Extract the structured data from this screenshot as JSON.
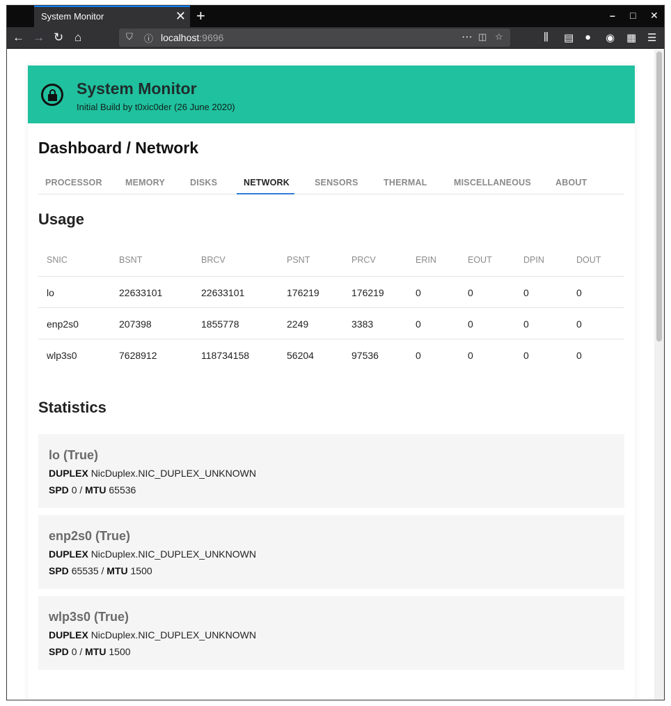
{
  "browser": {
    "tab_title": "System Monitor",
    "url_host": "localhost",
    "url_port": ":9696"
  },
  "header": {
    "title": "System Monitor",
    "subtitle": "Initial Build by t0xic0der (26 June 2020)"
  },
  "breadcrumb": "Dashboard / Network",
  "tabs": [
    {
      "label": "PROCESSOR"
    },
    {
      "label": "MEMORY"
    },
    {
      "label": "DISKS"
    },
    {
      "label": "NETWORK"
    },
    {
      "label": "SENSORS"
    },
    {
      "label": "THERMAL"
    },
    {
      "label": "MISCELLANEOUS"
    },
    {
      "label": "ABOUT"
    }
  ],
  "active_tab": "NETWORK",
  "usage": {
    "heading": "Usage",
    "columns": [
      "SNIC",
      "BSNT",
      "BRCV",
      "PSNT",
      "PRCV",
      "ERIN",
      "EOUT",
      "DPIN",
      "DOUT"
    ],
    "rows": [
      [
        "lo",
        "22633101",
        "22633101",
        "176219",
        "176219",
        "0",
        "0",
        "0",
        "0"
      ],
      [
        "enp2s0",
        "207398",
        "1855778",
        "2249",
        "3383",
        "0",
        "0",
        "0",
        "0"
      ],
      [
        "wlp3s0",
        "7628912",
        "118734158",
        "56204",
        "97536",
        "0",
        "0",
        "0",
        "0"
      ]
    ]
  },
  "statistics": {
    "heading": "Statistics",
    "duplex_label": "DUPLEX",
    "spd_label": "SPD",
    "mtu_label": "MTU",
    "separator": " / ",
    "items": [
      {
        "title": "lo (True)",
        "duplex": "NicDuplex.NIC_DUPLEX_UNKNOWN",
        "spd": "0",
        "mtu": "65536"
      },
      {
        "title": "enp2s0 (True)",
        "duplex": "NicDuplex.NIC_DUPLEX_UNKNOWN",
        "spd": "65535",
        "mtu": "1500"
      },
      {
        "title": "wlp3s0 (True)",
        "duplex": "NicDuplex.NIC_DUPLEX_UNKNOWN",
        "spd": "0",
        "mtu": "1500"
      }
    ]
  },
  "colors": {
    "hero": "#20c19e",
    "active_tab_underline": "#2e7bd6"
  }
}
